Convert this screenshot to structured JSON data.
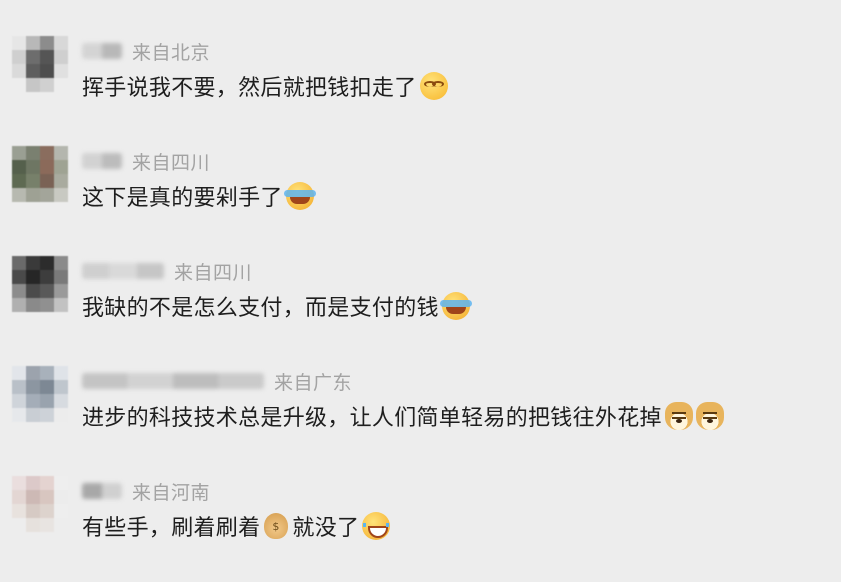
{
  "comments": [
    {
      "location": "来自北京",
      "text": "挥手说我不要，然后就把钱扣走了",
      "emojis": [
        "smirk-face-icon"
      ],
      "avatar_colors": [
        "#e6e6e6",
        "#b8b8b8",
        "#8c8c8c",
        "#d8d8d8",
        "#cfcfcf",
        "#6d6d6d",
        "#555555",
        "#cfcfcf",
        "#dadada",
        "#5e5e5e",
        "#4e4e4e",
        "#e0e0e0",
        "#ededed",
        "#c6c6c6",
        "#d0d0d0",
        "#ededed"
      ],
      "name_blur_colors": [
        "#d4d4d4",
        "#b8b8b8"
      ]
    },
    {
      "location": "来自四川",
      "text": "这下是真的要剁手了",
      "emojis": [
        "crying-laughing-face-icon"
      ],
      "avatar_colors": [
        "#9a9f93",
        "#7a8070",
        "#8a6d5e",
        "#b4b6ae",
        "#55604c",
        "#6e7663",
        "#8b6a5a",
        "#9fa393",
        "#5e6a52",
        "#77806a",
        "#7a6255",
        "#a9ab9f",
        "#b7b9b0",
        "#9ea194",
        "#a3a59a",
        "#c8c9c2"
      ],
      "name_blur_colors": [
        "#d2d2d2",
        "#bcbcbc"
      ]
    },
    {
      "location": "来自四川",
      "text": "我缺的不是怎么支付，而是支付的钱",
      "emojis": [
        "crying-laughing-face-icon"
      ],
      "avatar_colors": [
        "#6a6a6a",
        "#3a3a3a",
        "#2c2c2c",
        "#8b8b8b",
        "#4a4a4a",
        "#262626",
        "#3d3d3d",
        "#7a7a7a",
        "#8c8c8c",
        "#4b4b4b",
        "#595959",
        "#9a9a9a",
        "#b0b0b0",
        "#8a8a8a",
        "#909090",
        "#c2c2c2"
      ],
      "name_blur_colors": [
        "#cfcfcf",
        "#d9d9d9",
        "#c6c6c6"
      ]
    },
    {
      "location": "来自广东",
      "text": "进步的科技技术总是升级，让人们简单轻易的把钱往外花掉",
      "emojis": [
        "doge-face-icon",
        "doge-face-icon"
      ],
      "avatar_colors": [
        "#e2e5ea",
        "#9ca3ad",
        "#a8b1bb",
        "#dfe3e8",
        "#b9c0c8",
        "#8c96a1",
        "#7d8894",
        "#bfc6cd",
        "#cfd4da",
        "#a4adb8",
        "#99a3ae",
        "#d7dbe0",
        "#e6e8eb",
        "#c9ced4",
        "#cdd2d8",
        "#ececec"
      ],
      "name_blur_colors": [
        "#c4c4c4",
        "#d2d2d2",
        "#bdbdbd",
        "#cacaca"
      ]
    },
    {
      "location": "来自河南",
      "text_before": "有些手，刷着刷着",
      "text_after": "就没了",
      "emojis": [
        "money-bag-icon",
        "laughing-tears-face-icon"
      ],
      "avatar_colors": [
        "#eadede",
        "#dcc9c9",
        "#e4d3d0",
        "#eeeeee",
        "#e3d6d3",
        "#cdb9b5",
        "#d8c6c0",
        "#ececec",
        "#e8e2de",
        "#d6cac4",
        "#ddd3cd",
        "#eeeeee",
        "#ededed",
        "#e6e1dd",
        "#e8e4e1",
        "#ededed"
      ],
      "name_blur_colors": [
        "#a8a8a8",
        "#d0d0d0"
      ]
    }
  ]
}
